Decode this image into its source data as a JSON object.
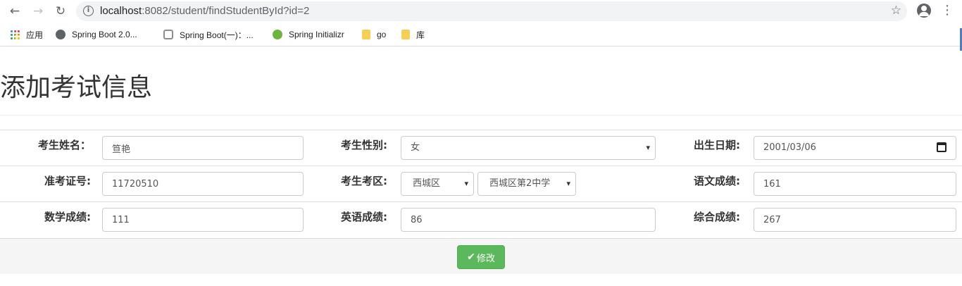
{
  "browser": {
    "url_host": "localhost",
    "url_rest": ":8082/student/findStudentById?id=2",
    "bookmarks": [
      {
        "label": "应用",
        "icon": "apps-icon"
      },
      {
        "label": "Spring Boot 2.0...",
        "icon": "globe-icon"
      },
      {
        "label": "Spring Boot(一)：...",
        "icon": "spring-boot-icon"
      },
      {
        "label": "Spring Initializr",
        "icon": "spring-initializr-icon"
      },
      {
        "label": "go",
        "icon": "folder-icon"
      },
      {
        "label": "库",
        "icon": "folder-icon"
      }
    ]
  },
  "page": {
    "title": "添加考试信息"
  },
  "form": {
    "name_label": "考生姓名：",
    "name_value": "笪艳",
    "gender_label": "考生性别:",
    "gender_value": "女",
    "birth_label": "出生日期:",
    "birth_value": "2001/03/06",
    "exam_no_label": "准考证号:",
    "exam_no_value": "11720510",
    "district_label": "考生考区:",
    "district_value": "西城区",
    "school_value": "西城区第2中学",
    "chinese_label": "语文成绩:",
    "chinese_value": "161",
    "math_label": "数学成绩:",
    "math_value": "111",
    "english_label": "英语成绩:",
    "english_value": "86",
    "composite_label": "综合成绩:",
    "composite_value": "267"
  },
  "actions": {
    "save_label": "修改"
  },
  "colors": {
    "button_green": "#5cb85c"
  }
}
